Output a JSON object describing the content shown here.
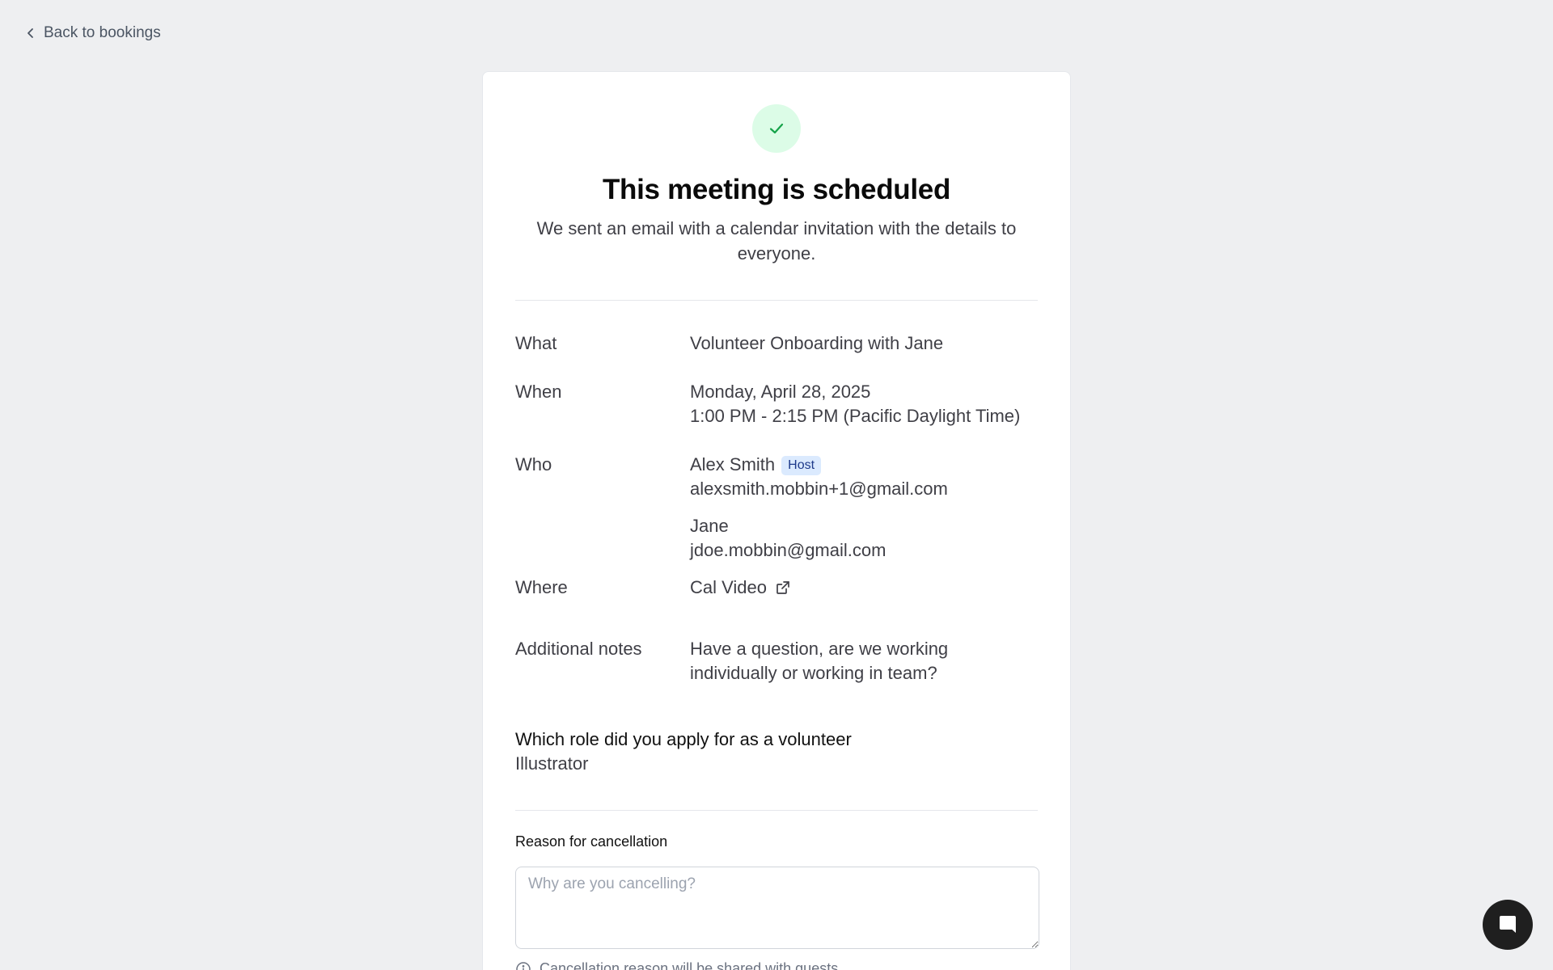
{
  "nav": {
    "back_label": "Back to bookings"
  },
  "header": {
    "title": "This meeting is scheduled",
    "subtitle": "We sent an email with a calendar invitation with the details to everyone."
  },
  "details": {
    "what": {
      "label": "What",
      "value": "Volunteer Onboarding with Jane"
    },
    "when": {
      "label": "When",
      "date": "Monday, April 28, 2025",
      "time": "1:00 PM - 2:15 PM (Pacific Daylight Time)"
    },
    "who": {
      "label": "Who",
      "attendees": [
        {
          "name": "Alex Smith",
          "badge": "Host",
          "email": "alexsmith.mobbin+1@gmail.com"
        },
        {
          "name": "Jane",
          "email": "jdoe.mobbin@gmail.com"
        }
      ]
    },
    "where": {
      "label": "Where",
      "value": "Cal Video"
    },
    "notes": {
      "label": "Additional notes",
      "value": "Have a question, are we working individually or working in team?"
    }
  },
  "question": {
    "label": "Which role did you apply for as a volunteer",
    "answer": "Illustrator"
  },
  "cancellation": {
    "label": "Reason for cancellation",
    "placeholder": "Why are you cancelling?",
    "note": "Cancellation reason will be shared with guests"
  },
  "colors": {
    "background": "#eeeff1",
    "success_bg": "#dcfce7",
    "success_icon": "#16a34a",
    "badge_bg": "#dbeafe",
    "chat_button": "#1f1f1f"
  },
  "icons": {
    "back": "chevron-left-icon",
    "success": "check-icon",
    "external_link": "external-link-icon",
    "info": "info-icon",
    "chat": "chat-icon"
  }
}
